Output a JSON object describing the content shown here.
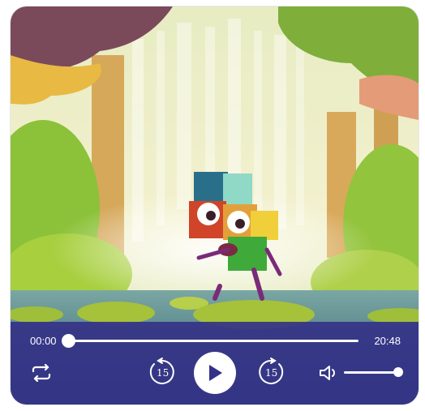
{
  "player": {
    "current_time": "00:00",
    "duration": "20:48",
    "progress": 0,
    "volume": 1,
    "skip_back_seconds": "15",
    "skip_forward_seconds": "15"
  },
  "icons": {
    "repeat": "repeat-icon",
    "rewind": "rewind-15-icon",
    "play": "play-icon",
    "forward": "forward-15-icon",
    "volume": "volume-icon"
  },
  "colors": {
    "control_bar": "#343287",
    "control_foreground": "#ffffff",
    "play_glyph": "#343287"
  }
}
